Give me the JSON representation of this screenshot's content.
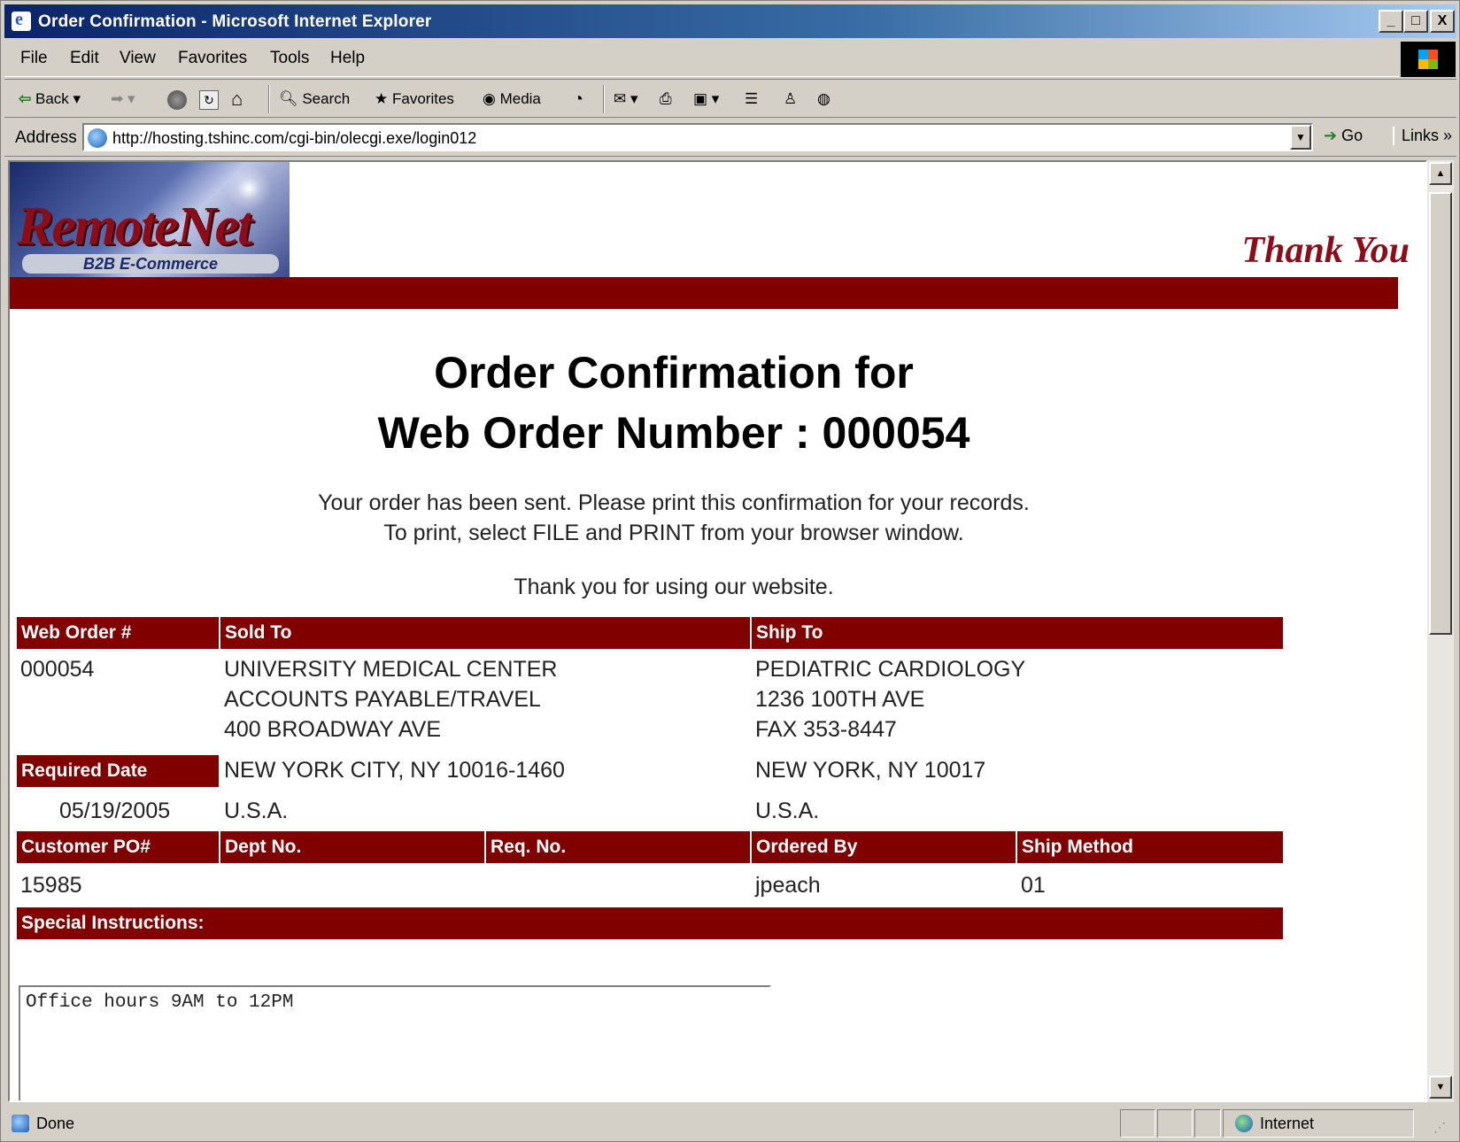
{
  "window": {
    "title": "Order Confirmation - Microsoft Internet Explorer",
    "minimize": "_",
    "maximize": "□",
    "close": "X"
  },
  "menu": [
    "File",
    "Edit",
    "View",
    "Favorites",
    "Tools",
    "Help"
  ],
  "toolbar": {
    "back": "Back",
    "search": "Search",
    "favorites": "Favorites",
    "media": "Media"
  },
  "address": {
    "label": "Address",
    "url": "http://hosting.tshinc.com/cgi-bin/olecgi.exe/login012",
    "go": "Go",
    "links": "Links »"
  },
  "banner": {
    "logo_text": "RemoteNet",
    "logo_sub": "B2B E-Commerce",
    "thank_you": "Thank You"
  },
  "heading": {
    "line1": "Order Confirmation for",
    "line2": "Web Order Number : 000054"
  },
  "message": {
    "line1": "Your order has been sent. Please print this confirmation for your records.",
    "line2": "To print, select FILE and PRINT from your browser window.",
    "thanks": "Thank you for using our website."
  },
  "order": {
    "headers": {
      "web_order": "Web Order #",
      "sold_to": "Sold To",
      "ship_to": "Ship To",
      "required_date": "Required Date",
      "customer_po": "Customer PO#",
      "dept_no": "Dept No.",
      "req_no": "Req. No.",
      "ordered_by": "Ordered By",
      "ship_method": "Ship Method",
      "special_instructions": "Special Instructions:"
    },
    "web_order_number": "000054",
    "sold_to": [
      "UNIVERSITY MEDICAL CENTER",
      "ACCOUNTS PAYABLE/TRAVEL",
      "400 BROADWAY AVE",
      "NEW YORK CITY, NY 10016-1460",
      "U.S.A."
    ],
    "ship_to": [
      "PEDIATRIC CARDIOLOGY",
      "1236 100TH AVE",
      "FAX 353-8447",
      "NEW YORK, NY 10017",
      "U.S.A."
    ],
    "required_date": "05/19/2005",
    "customer_po": "15985",
    "dept_no": "",
    "req_no": "",
    "ordered_by": "jpeach",
    "ship_method": "01",
    "special_instructions": "Office hours 9AM to 12PM"
  },
  "status": {
    "text": "Done",
    "zone": "Internet"
  }
}
